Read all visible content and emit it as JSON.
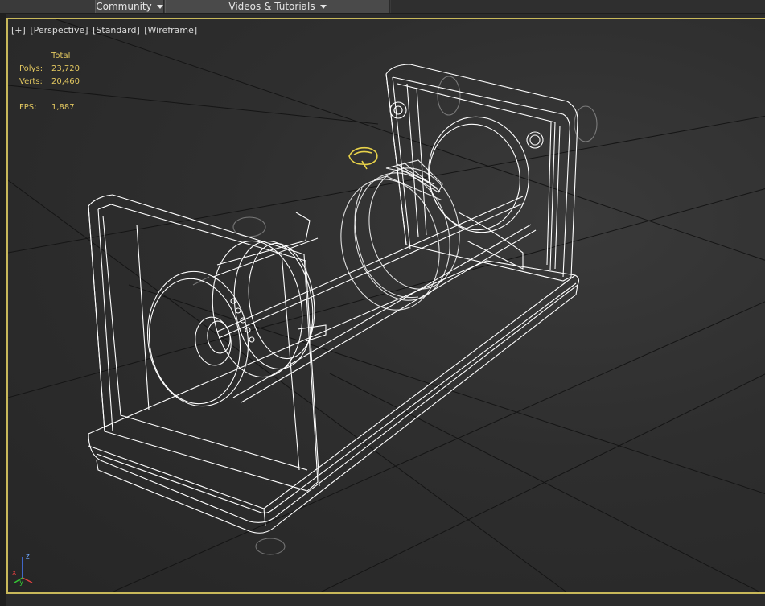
{
  "top_menu": {
    "community_label": "Community",
    "videos_label": "Videos & Tutorials"
  },
  "viewport": {
    "labels": [
      "[+]",
      "[Perspective]",
      "[Standard]",
      "[Wireframe]"
    ],
    "stats": {
      "total_label": "Total",
      "polys_label": "Polys:",
      "polys_value": "23,720",
      "verts_label": "Verts:",
      "verts_value": "20,460",
      "fps_label": "FPS:",
      "fps_value": "1,887"
    },
    "axis": {
      "z": "z",
      "y": "y",
      "x": "x"
    },
    "colors": {
      "wireframe": "#ffffff",
      "selected": "#e8d24a",
      "stats_text": "#e3c860",
      "active_border": "#c8b85a"
    }
  }
}
